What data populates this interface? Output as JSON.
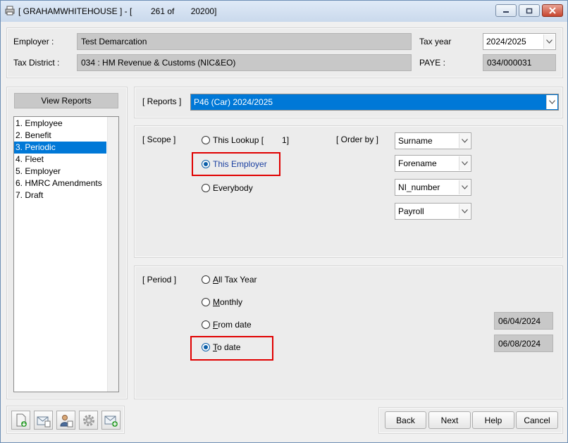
{
  "window": {
    "title": "[ GRAHAMWHITEHOUSE ] - [        261 of       20200]",
    "minimize_icon": "minimize-icon",
    "restore_icon": "restore-icon",
    "close_icon": "close-icon"
  },
  "header": {
    "employer_label": "Employer :",
    "employer_value": "Test Demarcation",
    "tax_district_label": "Tax District :",
    "tax_district_value": "034 : HM Revenue & Customs (NIC&EO)",
    "tax_year_label": "Tax year",
    "tax_year_value": "2024/2025",
    "paye_label": "PAYE :",
    "paye_value": "034/000031"
  },
  "sidebar": {
    "header": "View Reports",
    "items": [
      {
        "label": "1. Employee",
        "selected": false
      },
      {
        "label": "2. Benefit",
        "selected": false
      },
      {
        "label": "3. Periodic",
        "selected": true
      },
      {
        "label": "4. Fleet",
        "selected": false
      },
      {
        "label": "5. Employer",
        "selected": false
      },
      {
        "label": "6. HMRC Amendments",
        "selected": false
      },
      {
        "label": "7. Draft",
        "selected": false
      }
    ]
  },
  "reports": {
    "label": "[ Reports ]",
    "selected": "P46 (Car) 2024/2025"
  },
  "scope": {
    "label": "[ Scope ]",
    "options": {
      "this_lookup": "This Lookup [",
      "this_lookup_count": "1]",
      "this_employer": "This Employer",
      "everybody": "Everybody"
    },
    "selected": "this_employer",
    "order_by_label": "[ Order by ]",
    "order_by": [
      "Surname",
      "Forename",
      "NI_number",
      "Payroll"
    ]
  },
  "period": {
    "label": "[ Period ]",
    "all_tax_year_first": "A",
    "all_tax_year_rest": "ll Tax Year",
    "monthly_first": "M",
    "monthly_rest": "onthly",
    "from_date_first": "F",
    "from_date_rest": "rom date",
    "to_date_first": "T",
    "to_date_rest": "o date",
    "selected": "to_date",
    "from_date_value": "06/04/2024",
    "to_date_value": "06/08/2024"
  },
  "toolbar": {
    "icons": [
      "export-document-icon",
      "email-report-icon",
      "user-settings-icon",
      "gear-icon",
      "add-email-icon"
    ]
  },
  "buttons": {
    "back": "Back",
    "next": "Next",
    "help": "Help",
    "cancel": "Cancel"
  },
  "colors": {
    "selection": "#0078d7",
    "highlight": "#e00000"
  }
}
